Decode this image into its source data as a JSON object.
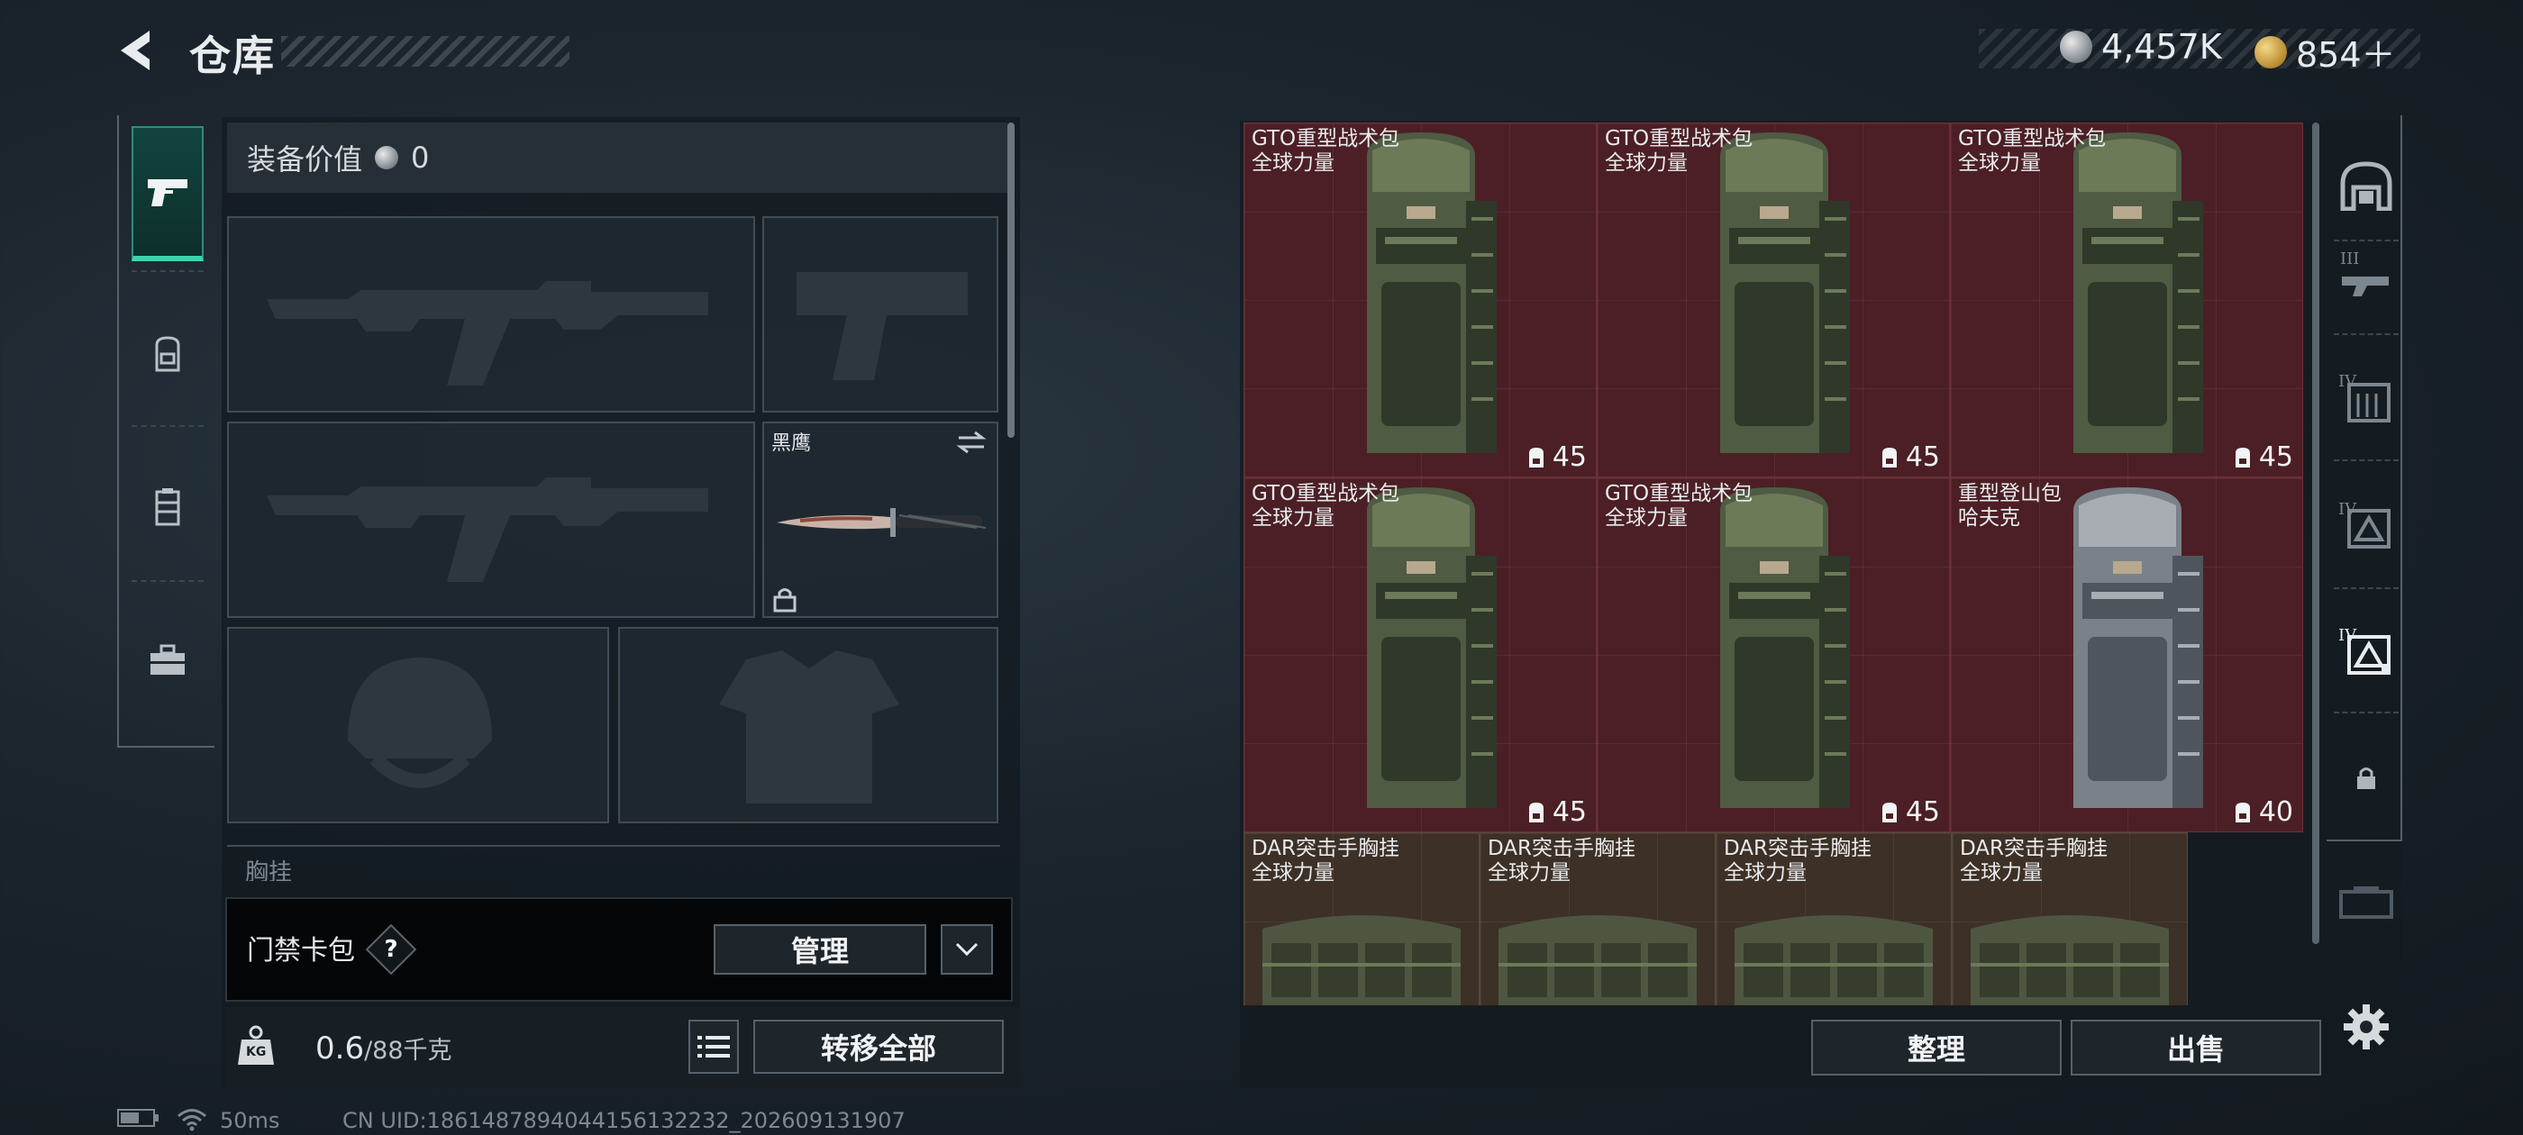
{
  "header": {
    "title": "仓库",
    "currency_silver": "4,457K",
    "currency_gold": "854＋"
  },
  "left_rail": {
    "tabs": [
      {
        "icon": "pistol-icon",
        "active": true
      },
      {
        "icon": "backpack-icon",
        "active": false
      },
      {
        "icon": "vest-icon",
        "active": false
      },
      {
        "icon": "toolbox-icon",
        "active": false
      }
    ]
  },
  "loadout": {
    "value_label": "装备价值",
    "value_amount": "0",
    "melee_name": "黑鹰",
    "chest_rig_label": "胸挂",
    "card_pack_label": "门禁卡包",
    "help_symbol": "?",
    "manage_label": "管理",
    "weight_value": "0.6",
    "weight_capacity": "/88千克",
    "weight_icon_text": "KG",
    "transfer_all_label": "转移全部"
  },
  "storage": {
    "items": [
      {
        "name": "GTO重型战术包",
        "brand": "全球力量",
        "capacity": "45",
        "type": "backpack"
      },
      {
        "name": "GTO重型战术包",
        "brand": "全球力量",
        "capacity": "45",
        "type": "backpack"
      },
      {
        "name": "GTO重型战术包",
        "brand": "全球力量",
        "capacity": "45",
        "type": "backpack"
      },
      {
        "name": "GTO重型战术包",
        "brand": "全球力量",
        "capacity": "45",
        "type": "backpack"
      },
      {
        "name": "GTO重型战术包",
        "brand": "全球力量",
        "capacity": "45",
        "type": "backpack"
      },
      {
        "name": "重型登山包",
        "brand": "哈夫克",
        "capacity": "40",
        "type": "backpack-grey"
      },
      {
        "name": "DAR突击手胸挂",
        "brand": "全球力量",
        "capacity": "",
        "type": "rig"
      },
      {
        "name": "DAR突击手胸挂",
        "brand": "全球力量",
        "capacity": "",
        "type": "rig"
      },
      {
        "name": "DAR突击手胸挂",
        "brand": "全球力量",
        "capacity": "",
        "type": "rig"
      },
      {
        "name": "DAR突击手胸挂",
        "brand": "全球力量",
        "capacity": "",
        "type": "rig"
      }
    ],
    "sort_label": "整理",
    "sell_label": "出售"
  },
  "right_rail": {
    "tiers": [
      "III",
      "IV",
      "IV",
      "IV"
    ]
  },
  "status": {
    "ping": "50ms",
    "uid": "CN UID:1861487894044156132232_202609131907"
  },
  "colors": {
    "accent": "#3fd3ab",
    "item_red": "#4b1f25",
    "item_brown": "#3d3026"
  }
}
